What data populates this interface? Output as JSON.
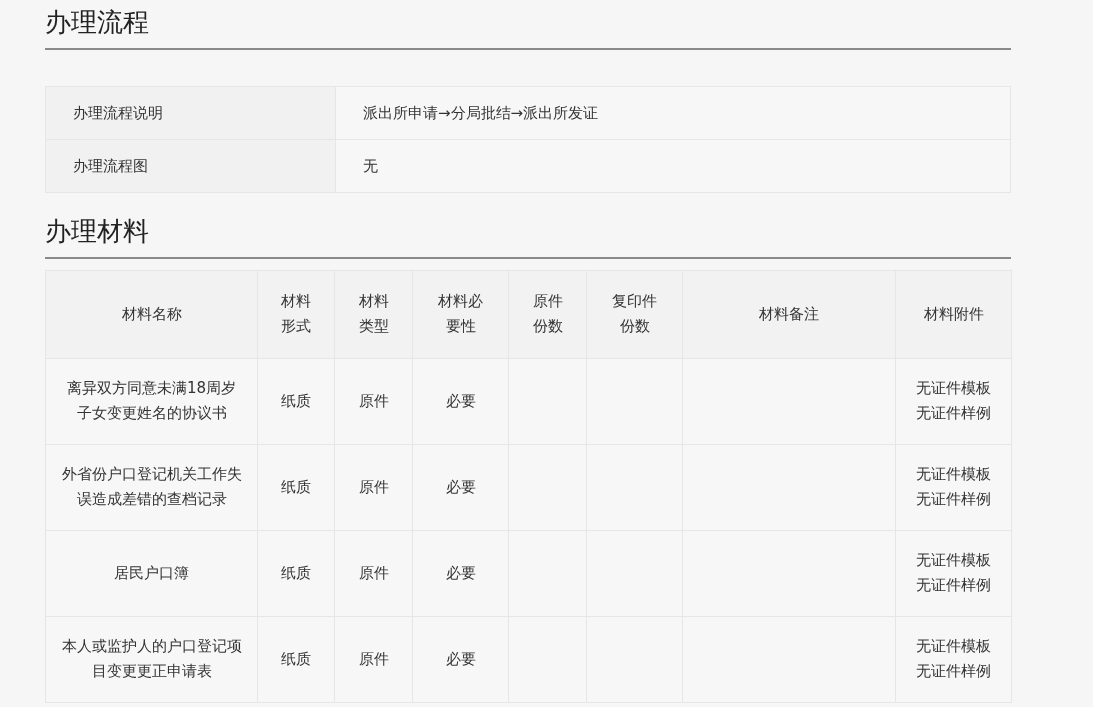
{
  "process_section": {
    "heading": "办理流程",
    "rows": [
      {
        "label": "办理流程说明",
        "value": "派出所申请→分局批结→派出所发证"
      },
      {
        "label": "办理流程图",
        "value": "无"
      }
    ]
  },
  "materials_section": {
    "heading": "办理材料",
    "columns": [
      "材料名称",
      "材料形式",
      "材料类型",
      "材料必要性",
      "原件份数",
      "复印件份数",
      "材料备注",
      "材料附件"
    ],
    "rows": [
      {
        "name": "离异双方同意未满18周岁子女变更姓名的协议书",
        "form": "纸质",
        "type": "原件",
        "necessity": "必要",
        "attachments": [
          "无证件模板",
          "无证件样例"
        ]
      },
      {
        "name": "外省份户口登记机关工作失误造成差错的查档记录",
        "form": "纸质",
        "type": "原件",
        "necessity": "必要",
        "attachments": [
          "无证件模板",
          "无证件样例"
        ]
      },
      {
        "name": "居民户口簿",
        "form": "纸质",
        "type": "原件",
        "necessity": "必要",
        "attachments": [
          "无证件模板",
          "无证件样例"
        ]
      },
      {
        "name": "本人或监护人的户口登记项目变更更正申请表",
        "form": "纸质",
        "type": "原件",
        "necessity": "必要",
        "attachments": [
          "无证件模板",
          "无证件样例"
        ]
      }
    ]
  }
}
